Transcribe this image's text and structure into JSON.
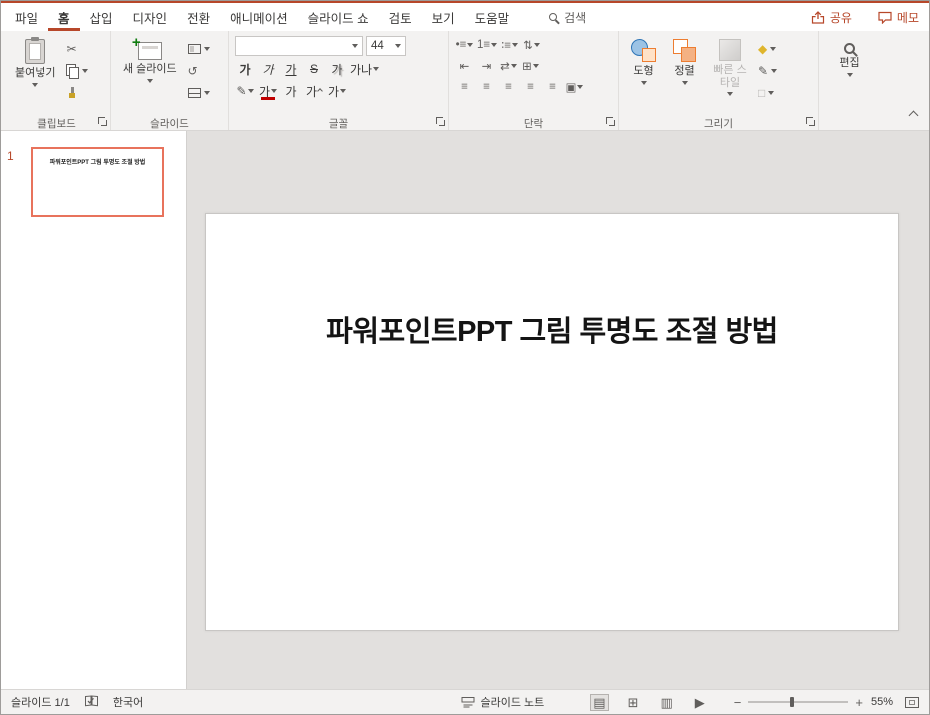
{
  "colors": {
    "accent": "#b7472a",
    "thumbnail_selection": "#e8735c",
    "slide_background": "#ffffff",
    "editor_background": "#e2e0de"
  },
  "menubar": {
    "tabs": [
      "파일",
      "홈",
      "삽입",
      "디자인",
      "전환",
      "애니메이션",
      "슬라이드 쇼",
      "검토",
      "보기",
      "도움말"
    ],
    "active_tab": "홈",
    "search_label": "검색",
    "share_label": "공유",
    "memo_label": "메모"
  },
  "ribbon": {
    "clipboard": {
      "label": "클립보드",
      "paste": "붙여넣기"
    },
    "slides": {
      "label": "슬라이드",
      "new_slide": "새 슬라이드"
    },
    "font": {
      "label": "글꼴",
      "font_name": "",
      "font_size": "44",
      "bold": "가",
      "italic": "가",
      "underline": "가",
      "strikethrough": "S",
      "shadow": "가",
      "spacing": "가나",
      "font_color": "가",
      "clear": "가",
      "grow": "가",
      "shrink": "가"
    },
    "paragraph": {
      "label": "단락"
    },
    "drawing": {
      "label": "그리기",
      "shapes": "도형",
      "arrange": "정렬",
      "quick_styles": "빠른 스타일"
    },
    "editing": {
      "label": "편집"
    }
  },
  "icons": {
    "scissors": "✂",
    "reset": "↺",
    "bullets": "•≡",
    "numbering": "1≡",
    "multilevel": "∶≡",
    "line_spacing": "⇅",
    "outdent": "⇤",
    "indent": "⇥",
    "direction": "⇄",
    "columns": "⊞",
    "smartart": "▣",
    "align_left": "≡",
    "align_center": "≡",
    "align_right": "≡",
    "justify": "≡",
    "distribute": "≡",
    "pen": "✎",
    "fill_diamond": "◆",
    "effects_square": "□",
    "view_normal": "▤",
    "view_sorter": "⊞",
    "view_reading": "▥",
    "view_show": "▶"
  },
  "thumbnails": {
    "slide_number": "1",
    "title": "파워포인트PPT 그림 투명도 조절 방법"
  },
  "slide": {
    "title": "파워포인트PPT 그림 투명도 조절 방법"
  },
  "statusbar": {
    "slide_indicator": "슬라이드 1/1",
    "language": "한국어",
    "notes": "슬라이드 노트",
    "zoom_out": "−",
    "zoom_in": "+",
    "zoom_level": "55%"
  }
}
